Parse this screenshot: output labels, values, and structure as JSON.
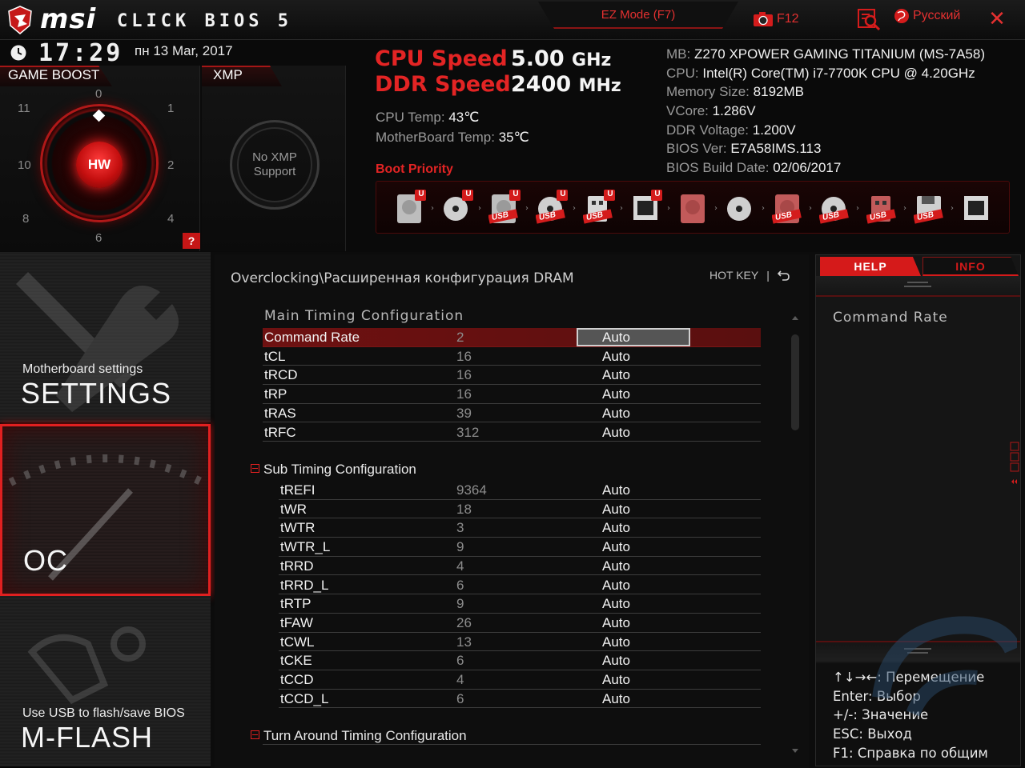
{
  "header": {
    "brand": "msi",
    "product": "CLICK BIOS 5",
    "ez_mode": "EZ Mode (F7)",
    "screenshot_key": "F12",
    "language": "Русский",
    "colors": {
      "accent": "#e32424",
      "bg": "#0c0c0c"
    }
  },
  "status": {
    "time": "17:29",
    "date": "пн  13 Mar, 2017",
    "game_boost": {
      "title": "GAME BOOST",
      "center_label": "HW",
      "dial_numbers": [
        "0",
        "1",
        "2",
        "4",
        "6",
        "8",
        "10",
        "11"
      ],
      "help_label": "?"
    },
    "xmp": {
      "title": "XMP",
      "message_line1": "No XMP",
      "message_line2": "Support"
    },
    "cpu_speed": {
      "label": "CPU Speed",
      "value": "5.00",
      "unit": "GHz"
    },
    "ddr_speed": {
      "label": "DDR Speed",
      "value": "2400",
      "unit": "MHz"
    },
    "cpu_temp": {
      "label": "CPU Temp:",
      "value": "43℃"
    },
    "mb_temp": {
      "label": "MotherBoard Temp:",
      "value": "35℃"
    },
    "sysinfo": [
      {
        "label": "MB:",
        "value": "Z270 XPOWER GAMING TITANIUM (MS-7A58)"
      },
      {
        "label": "CPU:",
        "value": "Intel(R) Core(TM) i7-7700K CPU @ 4.20GHz"
      },
      {
        "label": "Memory Size:",
        "value": "8192MB"
      },
      {
        "label": "VCore:",
        "value": "1.286V"
      },
      {
        "label": "DDR Voltage:",
        "value": "1.200V"
      },
      {
        "label": "BIOS Ver:",
        "value": "E7A58IMS.113"
      },
      {
        "label": "BIOS Build Date:",
        "value": "02/06/2017"
      }
    ],
    "boot_priority": {
      "title": "Boot Priority",
      "devices": [
        {
          "icon": "hdd-icon",
          "badge": "U"
        },
        {
          "icon": "optical-disc-icon",
          "badge": "U"
        },
        {
          "icon": "usb-hdd-icon",
          "badge": "U",
          "text": "USB"
        },
        {
          "icon": "usb-disc-icon",
          "badge": "U",
          "text": "USB"
        },
        {
          "icon": "usb-key-icon",
          "badge": "U",
          "text": "USB"
        },
        {
          "icon": "network-icon",
          "badge": "U"
        },
        {
          "icon": "hdd-icon",
          "badge": ""
        },
        {
          "icon": "optical-disc-icon",
          "badge": ""
        },
        {
          "icon": "usb-hdd-icon",
          "badge": "",
          "text": "USB"
        },
        {
          "icon": "usb-disc-icon",
          "badge": "",
          "text": "USB"
        },
        {
          "icon": "usb-key-icon",
          "badge": "",
          "text": "USB"
        },
        {
          "icon": "usb-floppy-icon",
          "badge": "",
          "text": "USB"
        },
        {
          "icon": "network-icon",
          "badge": ""
        }
      ]
    }
  },
  "nav": {
    "settings": {
      "sub": "Motherboard settings",
      "title": "SETTINGS"
    },
    "oc": {
      "title": "OC"
    },
    "mflash": {
      "sub": "Use USB to flash/save BIOS",
      "title": "M-FLASH"
    }
  },
  "main": {
    "breadcrumb": "Overclocking\\Расширенная конфигурация DRAM",
    "hotkey": "HOT KEY",
    "hotkey_sep": "|",
    "main_timing": {
      "title": "Main  Timing  Configuration",
      "rows": [
        {
          "name": "Command Rate",
          "value": "2",
          "setting": "Auto"
        },
        {
          "name": "tCL",
          "value": "16",
          "setting": "Auto"
        },
        {
          "name": "tRCD",
          "value": "16",
          "setting": "Auto"
        },
        {
          "name": "tRP",
          "value": "16",
          "setting": "Auto"
        },
        {
          "name": "tRAS",
          "value": "39",
          "setting": "Auto"
        },
        {
          "name": "tRFC",
          "value": "312",
          "setting": "Auto"
        }
      ]
    },
    "sub_timing": {
      "title": "Sub Timing Configuration",
      "rows": [
        {
          "name": "tREFI",
          "value": "9364",
          "setting": "Auto"
        },
        {
          "name": "tWR",
          "value": "18",
          "setting": "Auto"
        },
        {
          "name": "tWTR",
          "value": "3",
          "setting": "Auto"
        },
        {
          "name": "tWTR_L",
          "value": "9",
          "setting": "Auto"
        },
        {
          "name": "tRRD",
          "value": "4",
          "setting": "Auto"
        },
        {
          "name": "tRRD_L",
          "value": "6",
          "setting": "Auto"
        },
        {
          "name": "tRTP",
          "value": "9",
          "setting": "Auto"
        },
        {
          "name": "tFAW",
          "value": "26",
          "setting": "Auto"
        },
        {
          "name": "tCWL",
          "value": "13",
          "setting": "Auto"
        },
        {
          "name": "tCKE",
          "value": "6",
          "setting": "Auto"
        },
        {
          "name": "tCCD",
          "value": "4",
          "setting": "Auto"
        },
        {
          "name": "tCCD_L",
          "value": "6",
          "setting": "Auto"
        }
      ]
    },
    "turn_around": {
      "title": "Turn Around Timing Configuration"
    }
  },
  "help": {
    "tab_help": "HELP",
    "tab_info": "INFO",
    "text": "Command  Rate",
    "keys": [
      {
        "key": "↑↓→←:",
        "desc": "Перемещение"
      },
      {
        "key": "Enter:",
        "desc": "Выбор"
      },
      {
        "key": "+/-:",
        "desc": "Значение"
      },
      {
        "key": "ESC:",
        "desc": "Выход"
      },
      {
        "key": "F1:",
        "desc": "Справка по общим"
      }
    ]
  }
}
